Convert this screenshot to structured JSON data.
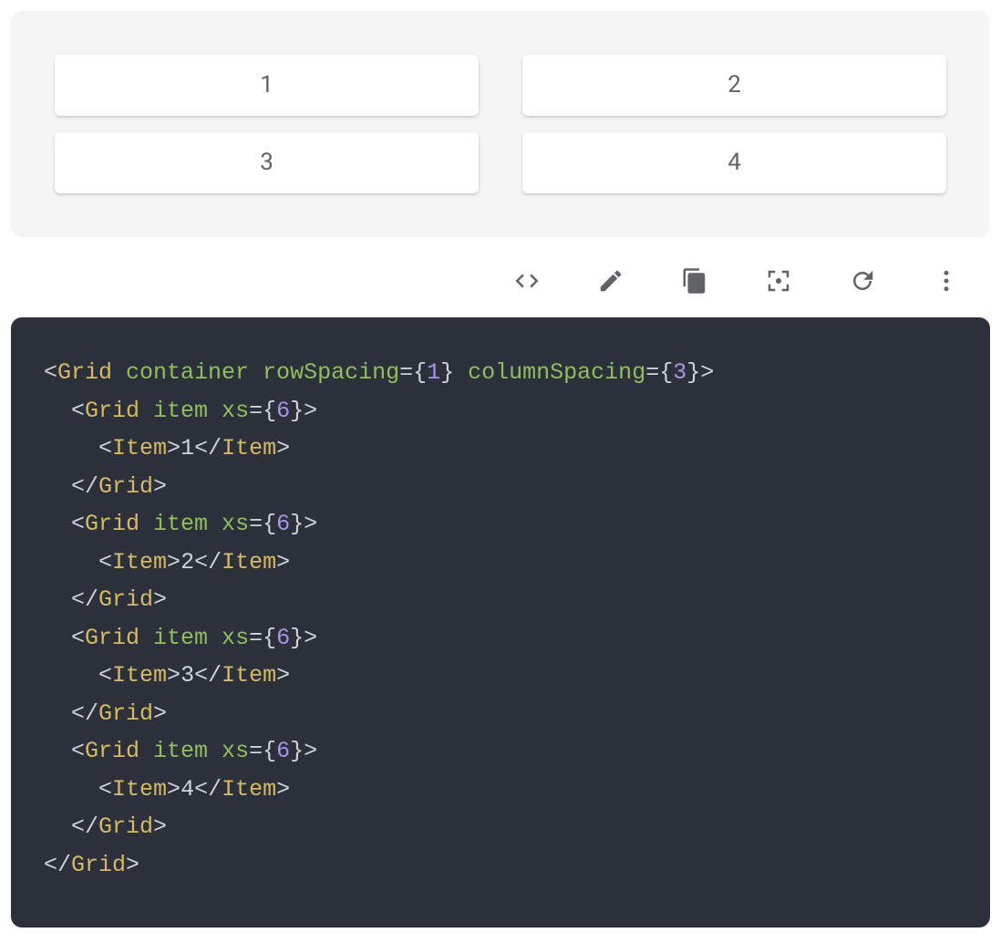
{
  "demo": {
    "items": [
      "1",
      "2",
      "3",
      "4"
    ]
  },
  "toolbar": {
    "icons": {
      "code": "code-icon",
      "edit": "pencil-icon",
      "copy": "copy-icon",
      "focus": "focus-icon",
      "reload": "reload-icon",
      "more": "more-vert-icon"
    }
  },
  "code": {
    "tokens": [
      [
        [
          "<",
          "punct"
        ],
        [
          "Grid",
          "tag"
        ],
        [
          " container rowSpacing",
          "attr"
        ],
        [
          "=",
          "punct"
        ],
        [
          "{",
          "punct"
        ],
        [
          "1",
          "num"
        ],
        [
          "}",
          "punct"
        ],
        [
          " columnSpacing",
          "attr"
        ],
        [
          "=",
          "punct"
        ],
        [
          "{",
          "punct"
        ],
        [
          "3",
          "num"
        ],
        [
          "}",
          "punct"
        ],
        [
          ">",
          "punct"
        ]
      ],
      [
        [
          "  ",
          "text"
        ],
        [
          "<",
          "punct"
        ],
        [
          "Grid",
          "tag"
        ],
        [
          " item xs",
          "attr"
        ],
        [
          "=",
          "punct"
        ],
        [
          "{",
          "punct"
        ],
        [
          "6",
          "num"
        ],
        [
          "}",
          "punct"
        ],
        [
          ">",
          "punct"
        ]
      ],
      [
        [
          "    ",
          "text"
        ],
        [
          "<",
          "punct"
        ],
        [
          "Item",
          "tag"
        ],
        [
          ">",
          "punct"
        ],
        [
          "1",
          "text"
        ],
        [
          "</",
          "punct"
        ],
        [
          "Item",
          "tag"
        ],
        [
          ">",
          "punct"
        ]
      ],
      [
        [
          "  ",
          "text"
        ],
        [
          "</",
          "punct"
        ],
        [
          "Grid",
          "tag"
        ],
        [
          ">",
          "punct"
        ]
      ],
      [
        [
          "  ",
          "text"
        ],
        [
          "<",
          "punct"
        ],
        [
          "Grid",
          "tag"
        ],
        [
          " item xs",
          "attr"
        ],
        [
          "=",
          "punct"
        ],
        [
          "{",
          "punct"
        ],
        [
          "6",
          "num"
        ],
        [
          "}",
          "punct"
        ],
        [
          ">",
          "punct"
        ]
      ],
      [
        [
          "    ",
          "text"
        ],
        [
          "<",
          "punct"
        ],
        [
          "Item",
          "tag"
        ],
        [
          ">",
          "punct"
        ],
        [
          "2",
          "text"
        ],
        [
          "</",
          "punct"
        ],
        [
          "Item",
          "tag"
        ],
        [
          ">",
          "punct"
        ]
      ],
      [
        [
          "  ",
          "text"
        ],
        [
          "</",
          "punct"
        ],
        [
          "Grid",
          "tag"
        ],
        [
          ">",
          "punct"
        ]
      ],
      [
        [
          "  ",
          "text"
        ],
        [
          "<",
          "punct"
        ],
        [
          "Grid",
          "tag"
        ],
        [
          " item xs",
          "attr"
        ],
        [
          "=",
          "punct"
        ],
        [
          "{",
          "punct"
        ],
        [
          "6",
          "num"
        ],
        [
          "}",
          "punct"
        ],
        [
          ">",
          "punct"
        ]
      ],
      [
        [
          "    ",
          "text"
        ],
        [
          "<",
          "punct"
        ],
        [
          "Item",
          "tag"
        ],
        [
          ">",
          "punct"
        ],
        [
          "3",
          "text"
        ],
        [
          "</",
          "punct"
        ],
        [
          "Item",
          "tag"
        ],
        [
          ">",
          "punct"
        ]
      ],
      [
        [
          "  ",
          "text"
        ],
        [
          "</",
          "punct"
        ],
        [
          "Grid",
          "tag"
        ],
        [
          ">",
          "punct"
        ]
      ],
      [
        [
          "  ",
          "text"
        ],
        [
          "<",
          "punct"
        ],
        [
          "Grid",
          "tag"
        ],
        [
          " item xs",
          "attr"
        ],
        [
          "=",
          "punct"
        ],
        [
          "{",
          "punct"
        ],
        [
          "6",
          "num"
        ],
        [
          "}",
          "punct"
        ],
        [
          ">",
          "punct"
        ]
      ],
      [
        [
          "    ",
          "text"
        ],
        [
          "<",
          "punct"
        ],
        [
          "Item",
          "tag"
        ],
        [
          ">",
          "punct"
        ],
        [
          "4",
          "text"
        ],
        [
          "</",
          "punct"
        ],
        [
          "Item",
          "tag"
        ],
        [
          ">",
          "punct"
        ]
      ],
      [
        [
          "  ",
          "text"
        ],
        [
          "</",
          "punct"
        ],
        [
          "Grid",
          "tag"
        ],
        [
          ">",
          "punct"
        ]
      ],
      [
        [
          "</",
          "punct"
        ],
        [
          "Grid",
          "tag"
        ],
        [
          ">",
          "punct"
        ]
      ]
    ]
  }
}
